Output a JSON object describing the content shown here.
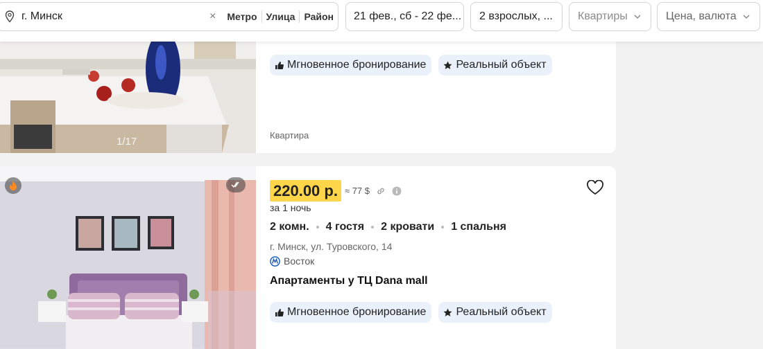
{
  "search": {
    "location_value": "г. Минск",
    "clear_symbol": "×",
    "location_modes": [
      "Метро",
      "Улица",
      "Район"
    ],
    "dates_value": "21 фев., сб - 22 фе...",
    "guests_value": "2 взрослых, ...",
    "type_placeholder": "Квартиры",
    "price_placeholder": "Цена, валюта"
  },
  "listings": [
    {
      "photo_counter": "1/17",
      "badges": [
        "Мгновенное бронирование",
        "Реальный объект"
      ],
      "kind": "Квартира"
    },
    {
      "price": "220.00 р.",
      "price_alt": "≈ 77 $",
      "per_night": "за 1 ночь",
      "features": [
        "2 комн.",
        "4 гостя",
        "2 кровати",
        "1 спальня"
      ],
      "address": "г. Минск, ул. Туровского, 14",
      "metro": "Восток",
      "title": "Апартаменты у ТЦ Dana mall",
      "badges": [
        "Мгновенное бронирование",
        "Реальный объект"
      ]
    }
  ],
  "icons": {
    "location": "map-pin-icon",
    "chevron": "chevron-down-icon",
    "thumbs_up": "thumbs-up-icon",
    "star": "star-icon",
    "heart": "heart-icon",
    "fire": "fire-icon",
    "verified": "double-check-icon",
    "metro": "metro-m-icon",
    "link": "link-icon",
    "info": "info-icon"
  },
  "colors": {
    "price_highlight": "#ffd54a",
    "badge_bg": "#eaf1fb",
    "metro_blue": "#1f5fbf"
  }
}
